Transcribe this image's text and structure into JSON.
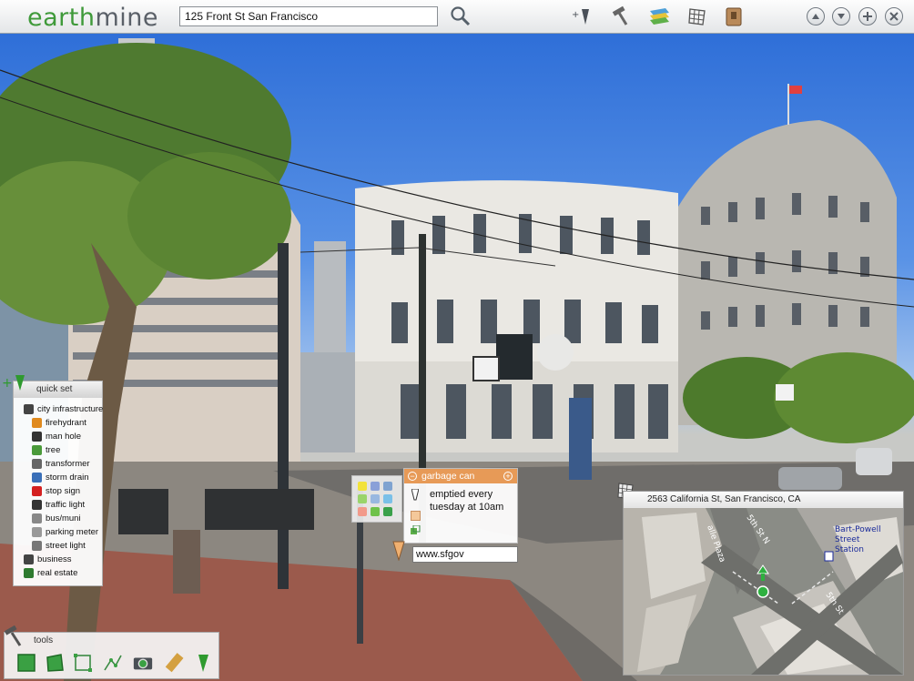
{
  "app": {
    "logo_part1": "earth",
    "logo_part2": "mine"
  },
  "toolbar": {
    "address_value": "125 Front St San Francisco",
    "icons": [
      "search-icon",
      "add-marker-icon",
      "hammer-icon",
      "layers-icon",
      "grid-icon",
      "bookmark-icon"
    ],
    "window_buttons": [
      "move-up-icon",
      "move-down-icon",
      "zoom-in-icon",
      "close-icon"
    ]
  },
  "quick_set": {
    "title": "quick set",
    "items": [
      {
        "label": "city infrastructure",
        "icon": "building-icon",
        "color": "#444444"
      },
      {
        "label": "firehydrant",
        "icon": "fire-hydrant-icon",
        "color": "#e08a1e"
      },
      {
        "label": "man hole",
        "icon": "manhole-icon",
        "color": "#333333"
      },
      {
        "label": "tree",
        "icon": "tree-icon",
        "color": "#4a9a3a"
      },
      {
        "label": "transformer",
        "icon": "transformer-icon",
        "color": "#666666"
      },
      {
        "label": "storm drain",
        "icon": "storm-drain-icon",
        "color": "#3a6fb8"
      },
      {
        "label": "stop sign",
        "icon": "stop-sign-icon",
        "color": "#d42020"
      },
      {
        "label": "traffic light",
        "icon": "traffic-light-icon",
        "color": "#333333"
      },
      {
        "label": "bus/muni",
        "icon": "bus-icon",
        "color": "#888888"
      },
      {
        "label": "parking meter",
        "icon": "parking-meter-icon",
        "color": "#999999"
      },
      {
        "label": "street light",
        "icon": "street-light-icon",
        "color": "#777777"
      },
      {
        "label": "business",
        "icon": "business-icon",
        "color": "#444444"
      },
      {
        "label": "real estate",
        "icon": "real-estate-icon",
        "color": "#2f7a2f"
      }
    ]
  },
  "tools": {
    "title": "tools",
    "items": [
      "polygon-tool-icon",
      "polygon-fill-tool-icon",
      "rectangle-tool-icon",
      "polyline-tool-icon",
      "camera-tool-icon",
      "ruler-tool-icon",
      "marker-tool-icon"
    ]
  },
  "annotation": {
    "title": "garbage can",
    "text": "emptied every tuesday at 10am",
    "url_value": "www.sfgov",
    "swatches": [
      "#f2e23a",
      "#8aa0d8",
      "#7fa3d0",
      "#9ad46a",
      "#99b8e0",
      "#7ac0e8",
      "#f29a8a",
      "#6fc24a",
      "#3aa04a"
    ]
  },
  "minimap": {
    "address": "2563 California St, San Francisco, CA",
    "street_labels": [
      "alle Plaza",
      "5th St N",
      "5th St"
    ],
    "station_label_lines": [
      "Bart-Powell",
      "Street",
      "Station"
    ]
  },
  "colors": {
    "accent_green": "#3f9a3a",
    "note_orange": "#e79a57",
    "sky_blue": "#3a78dd"
  }
}
